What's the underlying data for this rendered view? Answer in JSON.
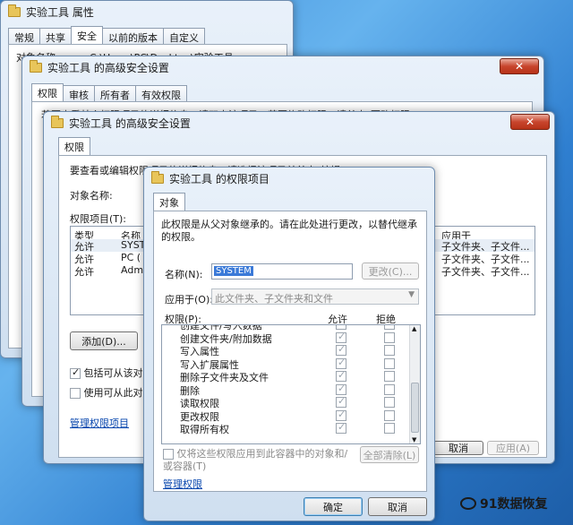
{
  "win1": {
    "title": "实验工具 属性",
    "tabs": [
      "常规",
      "共享",
      "安全",
      "以前的版本",
      "自定义"
    ],
    "object_label": "对象名称:",
    "object_path": "C:\\Users\\PC\\Desktop\\实验工具"
  },
  "win2": {
    "title": "实验工具 的高级安全设置",
    "tabs": [
      "权限",
      "审核",
      "所有者",
      "有效权限"
    ],
    "info": "若要查看某个权限项目的详细信息，请双击该项目。若要修改权限，请单击\"更改权限\"。"
  },
  "win3": {
    "title": "实验工具 的高级安全设置",
    "tab": "权限",
    "info": "要查看或编辑权限项目的详细信息，请选择该项目并单击\"编辑\"。",
    "object_label": "对象名称:",
    "entries_label": "权限项目(T):",
    "columns": [
      "类型",
      "名称"
    ],
    "apply_column": "应用于",
    "rows": [
      {
        "type": "允许",
        "name": "SYST",
        "apply": "子文件夹、子文件..."
      },
      {
        "type": "允许",
        "name": "PC (",
        "apply": "子文件夹、子文件..."
      },
      {
        "type": "允许",
        "name": "Admi",
        "apply": "子文件夹、子文件..."
      }
    ],
    "add_button": "添加(D)...",
    "include_inherit": "包括可从该对",
    "use_inherit": "使用可从此对",
    "manage_link": "管理权限项目",
    "cancel_button": "取消",
    "apply_button": "应用(A)"
  },
  "dialog": {
    "title": "实验工具 的权限项目",
    "tab": "对象",
    "info": "此权限是从父对象继承的。请在此处进行更改，以替代继承的权限。",
    "name_label": "名称(N):",
    "name_value": "SYSTEM",
    "change_button": "更改(C)...",
    "apply_label": "应用于(O):",
    "apply_value": "此文件夹、子文件夹和文件",
    "perm_label": "权限(P):",
    "allow_header": "允许",
    "deny_header": "拒绝",
    "permissions": [
      {
        "name": "创建文件/写入数据",
        "allow": true,
        "deny": false
      },
      {
        "name": "创建文件夹/附加数据",
        "allow": true,
        "deny": false
      },
      {
        "name": "写入属性",
        "allow": true,
        "deny": false
      },
      {
        "name": "写入扩展属性",
        "allow": true,
        "deny": false
      },
      {
        "name": "删除子文件夹及文件",
        "allow": true,
        "deny": false
      },
      {
        "name": "删除",
        "allow": true,
        "deny": false
      },
      {
        "name": "读取权限",
        "allow": true,
        "deny": false
      },
      {
        "name": "更改权限",
        "allow": true,
        "deny": false
      },
      {
        "name": "取得所有权",
        "allow": true,
        "deny": false
      }
    ],
    "only_apply": "仅将这些权限应用到此容器中的对象和/或容器(T)",
    "clear_all": "全部清除(L)",
    "manage_link": "管理权限",
    "ok_button": "确定",
    "cancel_button": "取消"
  },
  "watermark": "91数据恢复"
}
